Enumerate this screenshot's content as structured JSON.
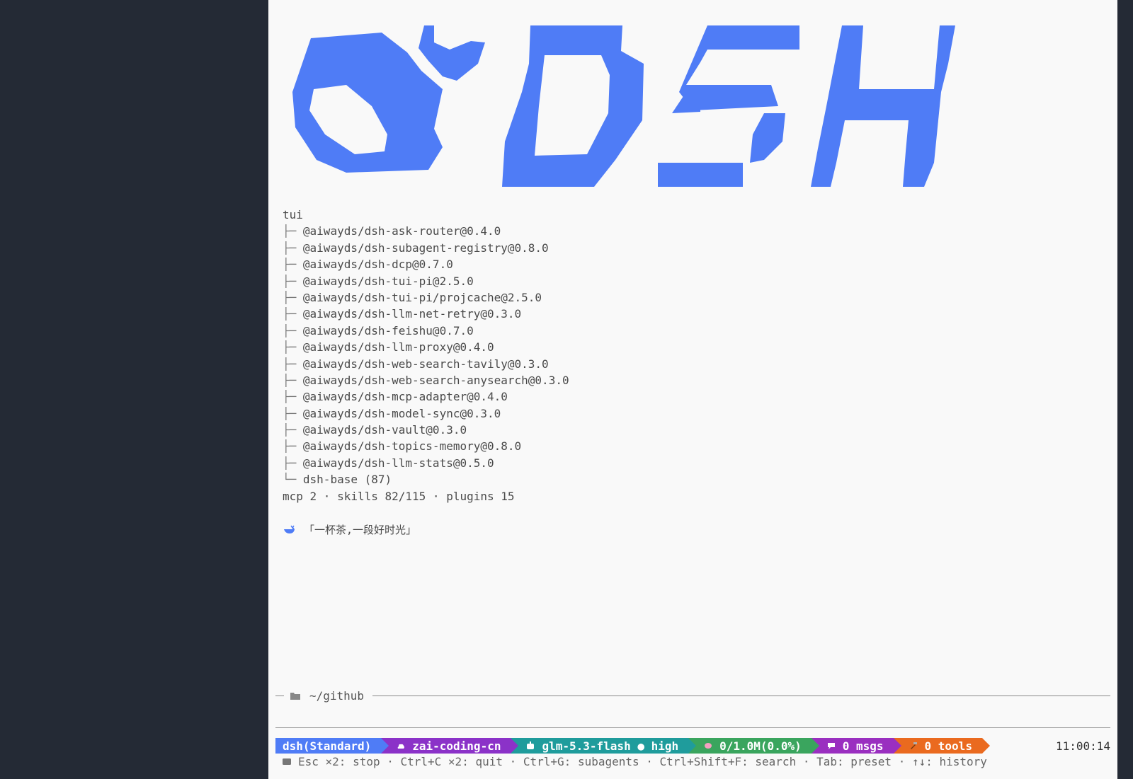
{
  "colors": {
    "logo": "#4f7cf6",
    "seg_mode": "#4f7cf6",
    "seg_provider": "#8b32c8",
    "seg_model": "#1f9c9c",
    "seg_context": "#3aa55e",
    "seg_msgs": "#9a2fc0",
    "seg_tools": "#ea6a1f"
  },
  "logo": {
    "text": "DSH",
    "icon": "whale-icon"
  },
  "tree": {
    "root": "tui",
    "items": [
      "@aiwayds/dsh-ask-router@0.4.0",
      "@aiwayds/dsh-subagent-registry@0.8.0",
      "@aiwayds/dsh-dcp@0.7.0",
      "@aiwayds/dsh-tui-pi@2.5.0",
      "@aiwayds/dsh-tui-pi/projcache@2.5.0",
      "@aiwayds/dsh-llm-net-retry@0.3.0",
      "@aiwayds/dsh-feishu@0.7.0",
      "@aiwayds/dsh-llm-proxy@0.4.0",
      "@aiwayds/dsh-web-search-tavily@0.3.0",
      "@aiwayds/dsh-web-search-anysearch@0.3.0",
      "@aiwayds/dsh-mcp-adapter@0.4.0",
      "@aiwayds/dsh-model-sync@0.3.0",
      "@aiwayds/dsh-vault@0.3.0",
      "@aiwayds/dsh-topics-memory@0.8.0",
      "@aiwayds/dsh-llm-stats@0.5.0",
      "dsh-base (87)"
    ],
    "branch_glyph": "├─",
    "last_glyph": "└─"
  },
  "summary": "mcp 2 · skills 82/115 · plugins 15",
  "quote": "「一杯茶,一段好时光」",
  "dir": "~/github",
  "status": {
    "mode": "dsh(Standard)",
    "provider": "zai-coding-cn",
    "model": "glm-5.3-flash ● high",
    "context": "0/1.0M(0.0%)",
    "msgs": "0 msgs",
    "tools": "0 tools",
    "clock": "11:00:14"
  },
  "hints": "Esc ×2: stop · Ctrl+C ×2: quit · Ctrl+G: subagents · Ctrl+Shift+F: search · Tab: preset · ↑↓: history"
}
